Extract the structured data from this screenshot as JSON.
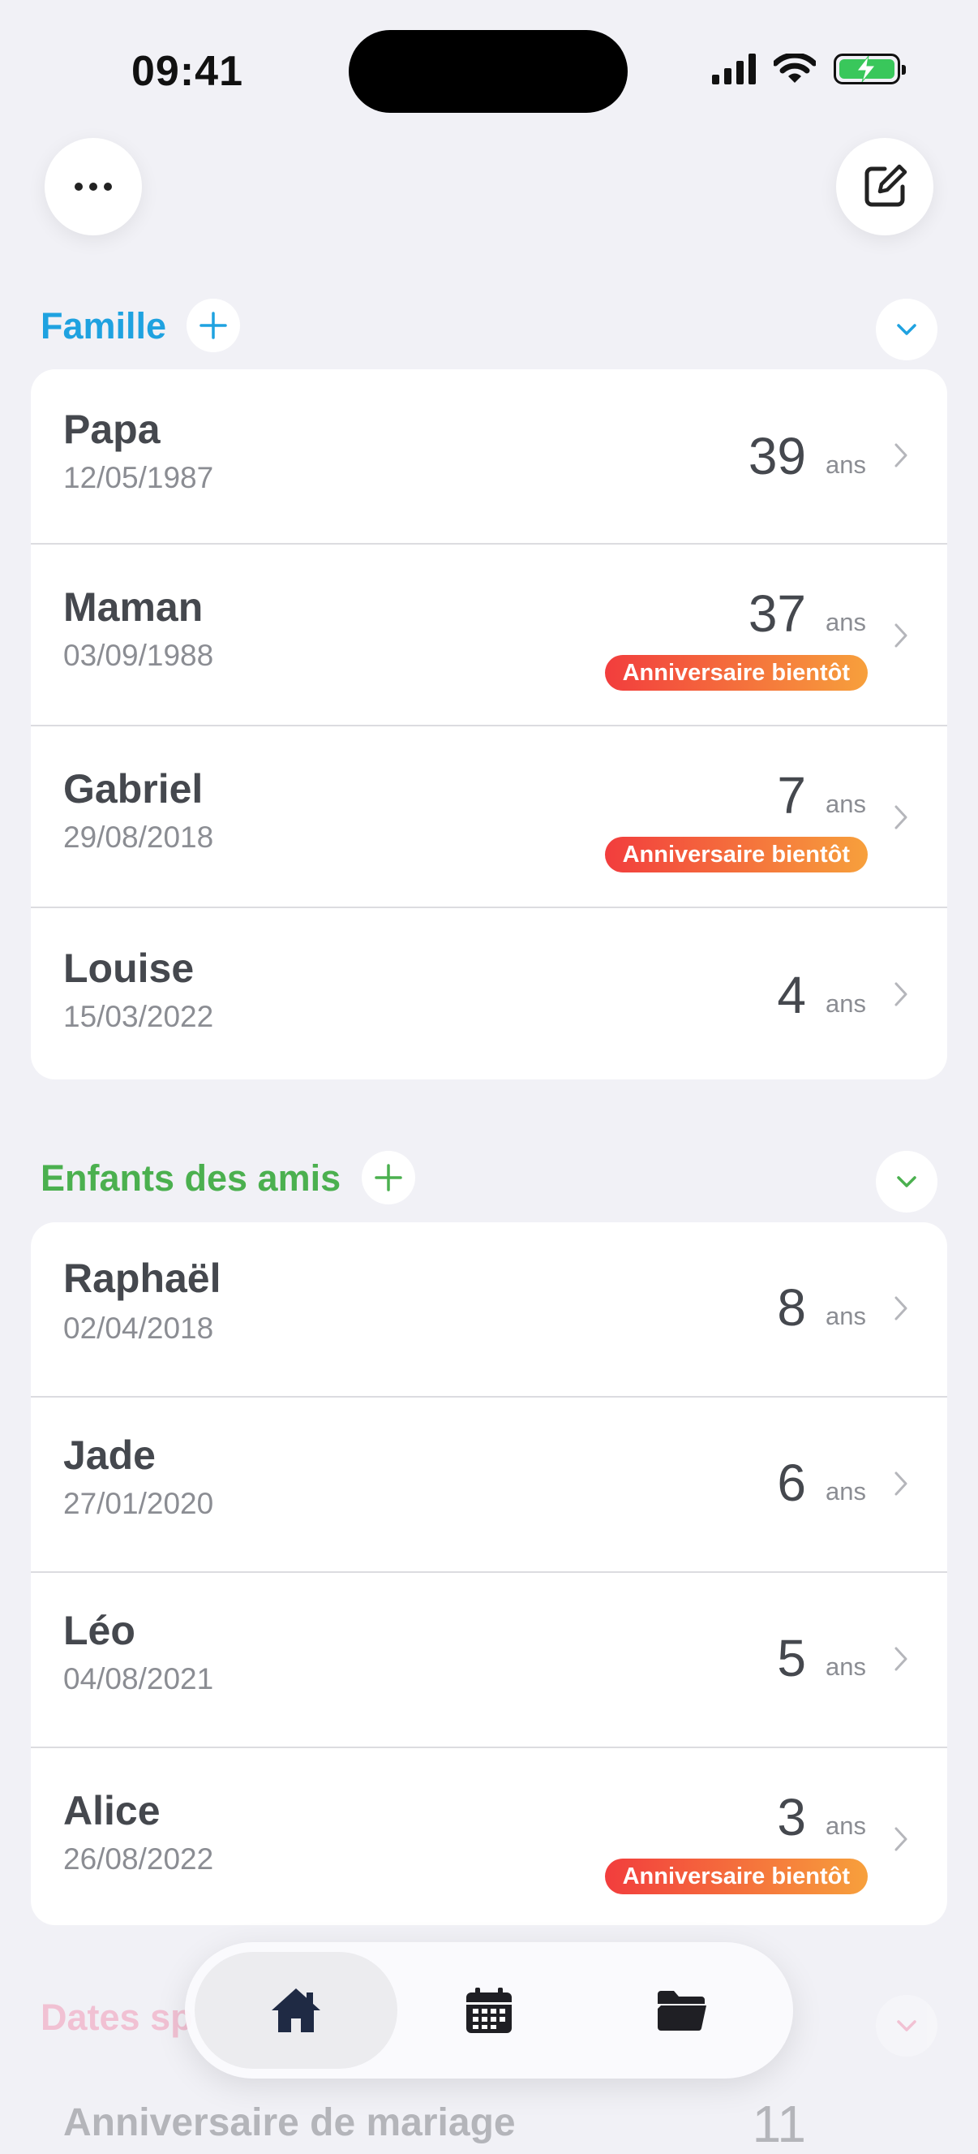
{
  "status_bar": {
    "time": "09:41"
  },
  "top_actions": {
    "menu_icon": "ellipsis-icon",
    "edit_icon": "compose-icon"
  },
  "sections": [
    {
      "title": "Famille",
      "color": "#1fa2e0",
      "people": [
        {
          "name": "Papa",
          "date": "12/05/1987",
          "age": "39",
          "unit": "ans",
          "badge": ""
        },
        {
          "name": "Maman",
          "date": "03/09/1988",
          "age": "37",
          "unit": "ans",
          "badge": "Anniversaire bientôt"
        },
        {
          "name": "Gabriel",
          "date": "29/08/2018",
          "age": "7",
          "unit": "ans",
          "badge": "Anniversaire bientôt"
        },
        {
          "name": "Louise",
          "date": "15/03/2022",
          "age": "4",
          "unit": "ans",
          "badge": ""
        }
      ]
    },
    {
      "title": "Enfants des amis",
      "color": "#4bb04f",
      "people": [
        {
          "name": "Raphaël",
          "date": "02/04/2018",
          "age": "8",
          "unit": "ans",
          "badge": ""
        },
        {
          "name": "Jade",
          "date": "27/01/2020",
          "age": "6",
          "unit": "ans",
          "badge": ""
        },
        {
          "name": "Léo",
          "date": "04/08/2021",
          "age": "5",
          "unit": "ans",
          "badge": ""
        },
        {
          "name": "Alice",
          "date": "26/08/2022",
          "age": "3",
          "unit": "ans",
          "badge": "Anniversaire bientôt"
        }
      ]
    },
    {
      "title": "Dates sp",
      "color": "#f26a93",
      "people": [
        {
          "name": "Anniversaire de mariage",
          "age": "11"
        }
      ]
    }
  ],
  "tab_bar": {
    "tabs": [
      {
        "icon": "house-icon",
        "active": true
      },
      {
        "icon": "calendar-icon",
        "active": false
      },
      {
        "icon": "folder-icon",
        "active": false
      }
    ]
  }
}
